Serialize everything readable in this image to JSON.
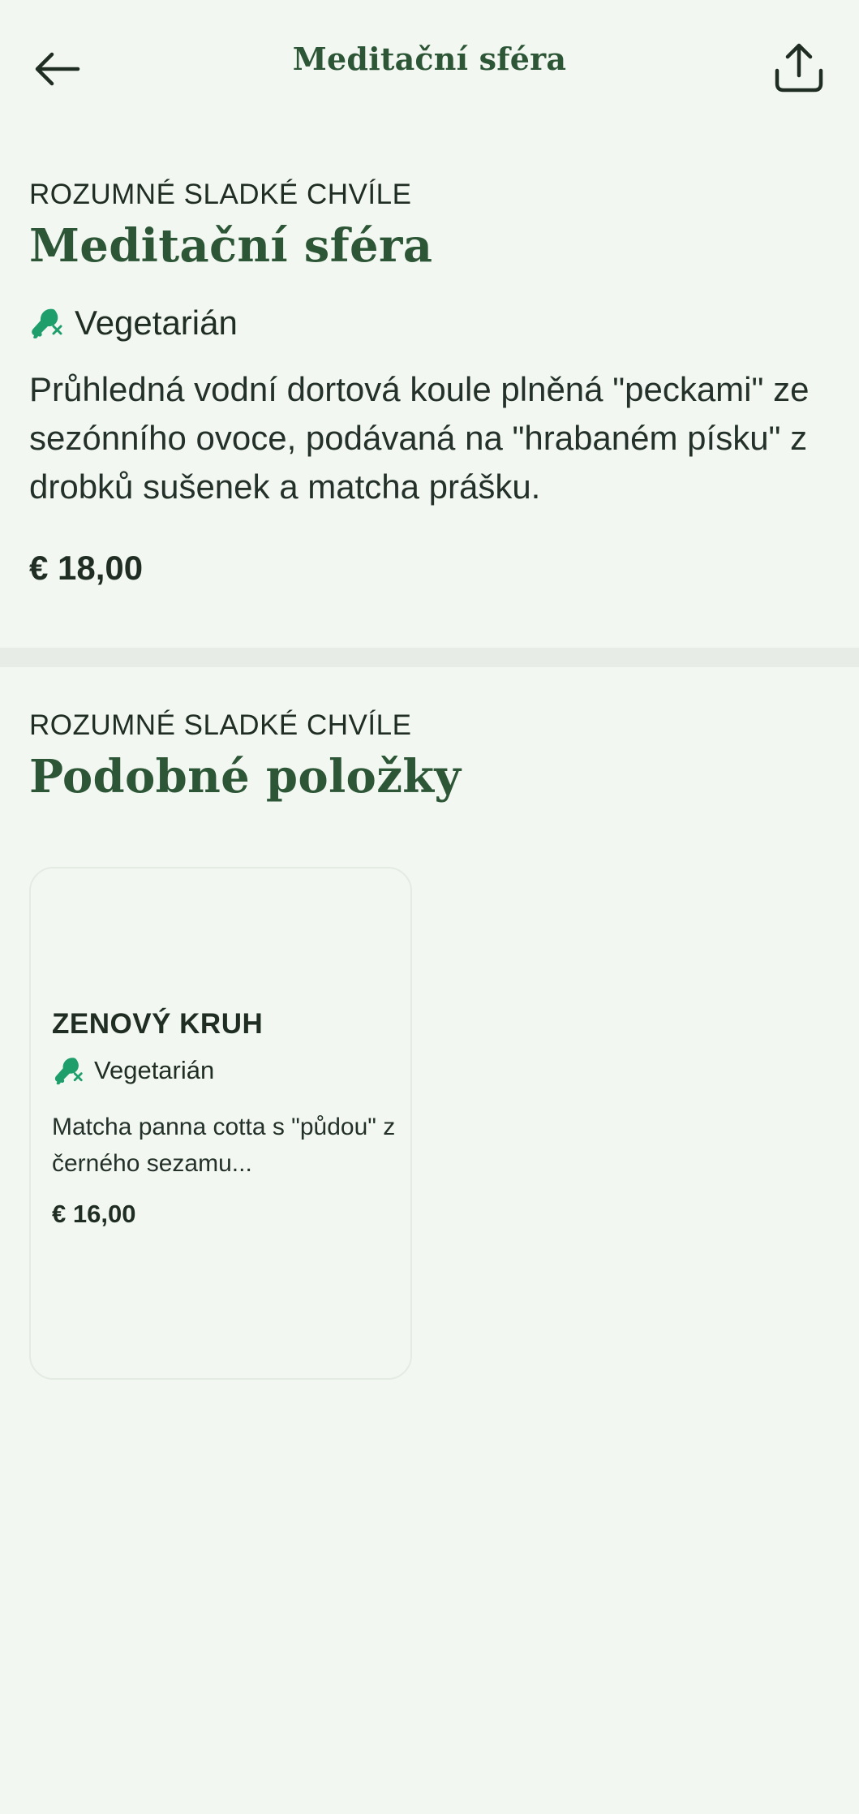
{
  "header": {
    "title": "Meditační sféra",
    "back_icon": "arrow-left-icon",
    "share_icon": "share-icon"
  },
  "item": {
    "category": "ROZUMNÉ SLADKÉ CHVÍLE",
    "name": "Meditační sféra",
    "diet": "Vegetarián",
    "diet_icon": "no-meat-icon",
    "description": "Průhledná vodní dortová koule plněná \"peckami\" ze sezónního ovoce, podávaná na \"hrabaném písku\" z drobků sušenek a matcha prášku.",
    "price": "€ 18,00"
  },
  "similar": {
    "category": "ROZUMNÉ SLADKÉ CHVÍLE",
    "title": "Podobné položky",
    "items": [
      {
        "name": "ZENOVÝ KRUH",
        "diet": "Vegetarián",
        "description": "Matcha panna cotta s \"půdou\" z černého sezamu...",
        "price": "€ 16,00"
      }
    ]
  },
  "colors": {
    "background": "#f3f7f2",
    "accent_green": "#2d5636",
    "icon_green": "#1e9e6a",
    "text": "#1f2d22",
    "divider": "#e7ede6"
  }
}
